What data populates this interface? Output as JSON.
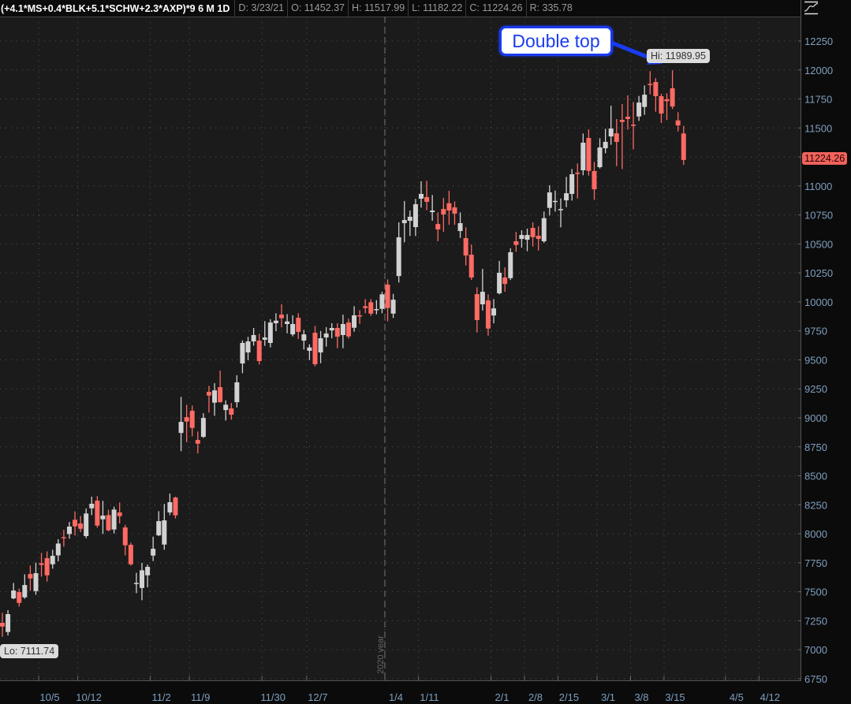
{
  "header": {
    "symbol": "(+4.1*MS+0.4*BLK+5.1*SCHW+2.3*AXP)*9",
    "period": "6 M 1D",
    "date": "D: 3/23/21",
    "open": "O: 11452.37",
    "high": "H: 11517.99",
    "low": "L: 11182.22",
    "close": "C: 11224.26",
    "range": "R: 335.78"
  },
  "annotations": {
    "callout": "Double top",
    "hi_label": "Hi: 11989.95",
    "lo_label": "Lo: 7111.74",
    "last_price": "11224.26",
    "year_marker": "2020 year"
  },
  "colors": {
    "up": "#d2d2d2",
    "down": "#ff6a63",
    "background": "#1b1b1b",
    "axis_text": "#7f9fbf",
    "callout": "#1a3cf0"
  },
  "chart_data": {
    "type": "candlestick",
    "title": "(+4.1*MS+0.4*BLK+5.1*SCHW+2.3*AXP)*9 6 M 1D",
    "ylim": [
      6650,
      12450
    ],
    "y_ticks": [
      12250,
      12000,
      11750,
      11500,
      11250,
      11000,
      10750,
      10500,
      10250,
      10000,
      9750,
      9500,
      9250,
      9000,
      8750,
      8500,
      8250,
      8000,
      7750,
      7500,
      7250,
      7000,
      6750
    ],
    "x_ticks": [
      {
        "label": "10/5",
        "index": 6.5
      },
      {
        "label": "10/12",
        "index": 13.5
      },
      {
        "label": "11/2",
        "index": 26.5
      },
      {
        "label": "11/9",
        "index": 33.5
      },
      {
        "label": "11/30",
        "index": 46.5
      },
      {
        "label": "12/7",
        "index": 54.5
      },
      {
        "label": "1/4",
        "index": 68.5
      },
      {
        "label": "1/11",
        "index": 74.5
      },
      {
        "label": "2/1",
        "index": 87.5
      },
      {
        "label": "2/8",
        "index": 93.5
      },
      {
        "label": "2/15",
        "index": 99.5
      },
      {
        "label": "3/1",
        "index": 106.5
      },
      {
        "label": "3/8",
        "index": 112.5
      },
      {
        "label": "3/15",
        "index": 118.5
      },
      {
        "label": "4/5",
        "index": 129.5
      },
      {
        "label": "4/12",
        "index": 135.5
      }
    ],
    "year_break_index": 68.5,
    "x_range": [
      -0.5,
      143.5
    ],
    "hi_index": 116,
    "lo_index": 0,
    "candles_ohlc": [
      [
        7232,
        7318,
        7112,
        7200
      ],
      [
        7153,
        7341,
        7123,
        7307
      ],
      [
        7443,
        7576,
        7436,
        7511
      ],
      [
        7497,
        7527,
        7372,
        7404
      ],
      [
        7452,
        7651,
        7440,
        7558
      ],
      [
        7653,
        7726,
        7508,
        7615
      ],
      [
        7506,
        7751,
        7474,
        7660
      ],
      [
        7746,
        7835,
        7631,
        7731
      ],
      [
        7790,
        7848,
        7588,
        7642
      ],
      [
        7737,
        7862,
        7699,
        7810
      ],
      [
        7814,
        7953,
        7762,
        7916
      ],
      [
        7971,
        8034,
        7889,
        7962
      ],
      [
        7998,
        8102,
        7957,
        8062
      ],
      [
        8121,
        8193,
        7985,
        8064
      ],
      [
        8089,
        8154,
        8014,
        8043
      ],
      [
        7980,
        8218,
        7962,
        8175
      ],
      [
        8220,
        8320,
        8161,
        8259
      ],
      [
        8286,
        8325,
        8053,
        8071
      ],
      [
        8125,
        8284,
        7998,
        8157
      ],
      [
        8161,
        8207,
        8021,
        8030
      ],
      [
        8037,
        8234,
        8003,
        8209
      ],
      [
        8184,
        8270,
        8089,
        8152
      ],
      [
        8055,
        8077,
        7814,
        7901
      ],
      [
        7905,
        7923,
        7726,
        7737
      ],
      [
        7570,
        7663,
        7488,
        7576
      ],
      [
        7533,
        7749,
        7427,
        7685
      ],
      [
        7642,
        7735,
        7538,
        7715
      ],
      [
        7812,
        7975,
        7765,
        7871
      ],
      [
        7987,
        8195,
        7980,
        8109
      ],
      [
        7907,
        8257,
        7862,
        8116
      ],
      [
        8184,
        8347,
        8161,
        8272
      ],
      [
        8313,
        8320,
        8132,
        8159
      ],
      [
        8870,
        9181,
        8712,
        8965
      ],
      [
        9006,
        9113,
        8791,
        8968
      ],
      [
        9061,
        9106,
        8841,
        8913
      ],
      [
        8809,
        8882,
        8693,
        8777
      ],
      [
        8836,
        9040,
        8827,
        8999
      ],
      [
        9224,
        9276,
        9045,
        9192
      ],
      [
        9131,
        9299,
        9018,
        9237
      ],
      [
        9265,
        9407,
        9131,
        9135
      ],
      [
        9067,
        9151,
        8977,
        9113
      ],
      [
        9081,
        9129,
        8984,
        9027
      ],
      [
        9135,
        9367,
        9090,
        9306
      ],
      [
        9469,
        9668,
        9385,
        9646
      ],
      [
        9564,
        9698,
        9498,
        9659
      ],
      [
        9659,
        9775,
        9623,
        9714
      ],
      [
        9666,
        9725,
        9460,
        9489
      ],
      [
        9673,
        9834,
        9621,
        9693
      ],
      [
        9646,
        9850,
        9607,
        9822
      ],
      [
        9816,
        9902,
        9748,
        9838
      ],
      [
        9890,
        9979,
        9781,
        9859
      ],
      [
        9809,
        9895,
        9729,
        9831
      ],
      [
        9720,
        9884,
        9702,
        9809
      ],
      [
        9863,
        9902,
        9680,
        9741
      ],
      [
        9666,
        9759,
        9589,
        9720
      ],
      [
        9578,
        9634,
        9498,
        9607
      ],
      [
        9734,
        9793,
        9444,
        9462
      ],
      [
        9564,
        9748,
        9471,
        9686
      ],
      [
        9693,
        9782,
        9614,
        9727
      ],
      [
        9754,
        9816,
        9686,
        9775
      ],
      [
        9775,
        9816,
        9600,
        9700
      ],
      [
        9714,
        9890,
        9600,
        9809
      ],
      [
        9822,
        9856,
        9684,
        9702
      ],
      [
        9777,
        9963,
        9743,
        9884
      ],
      [
        9884,
        9929,
        9811,
        9877
      ],
      [
        9963,
        10024,
        9902,
        9947
      ],
      [
        9997,
        10024,
        9879,
        9899
      ],
      [
        9934,
        10015,
        9893,
        9938
      ],
      [
        9940,
        10087,
        9902,
        10065
      ],
      [
        10149,
        10194,
        9833,
        9947
      ],
      [
        9899,
        10069,
        9861,
        10019
      ],
      [
        10223,
        10686,
        10167,
        10557
      ],
      [
        10679,
        10870,
        10514,
        10706
      ],
      [
        10699,
        10788,
        10568,
        10734
      ],
      [
        10645,
        10888,
        10568,
        10842
      ],
      [
        10890,
        11040,
        10813,
        10931
      ],
      [
        10904,
        11044,
        10790,
        10863
      ],
      [
        10774,
        10922,
        10700,
        10788
      ],
      [
        10672,
        10772,
        10523,
        10625
      ],
      [
        10801,
        10897,
        10604,
        10754
      ],
      [
        10851,
        10958,
        10665,
        10788
      ],
      [
        10815,
        10867,
        10665,
        10761
      ],
      [
        10611,
        10772,
        10552,
        10679
      ],
      [
        10550,
        10643,
        10314,
        10400
      ],
      [
        10407,
        10495,
        10189,
        10210
      ],
      [
        10067,
        10126,
        9736,
        9843
      ],
      [
        9979,
        10285,
        9926,
        10087
      ],
      [
        10013,
        10065,
        9709,
        9770
      ],
      [
        9883,
        10024,
        9815,
        9944
      ],
      [
        10074,
        10353,
        10065,
        10251
      ],
      [
        10210,
        10298,
        10087,
        10155
      ],
      [
        10205,
        10462,
        10189,
        10428
      ],
      [
        10523,
        10604,
        10432,
        10491
      ],
      [
        10543,
        10618,
        10468,
        10577
      ],
      [
        10536,
        10632,
        10437,
        10577
      ],
      [
        10638,
        10686,
        10477,
        10559
      ],
      [
        10570,
        10652,
        10443,
        10543
      ],
      [
        10523,
        10779,
        10509,
        10722
      ],
      [
        10811,
        11006,
        10745,
        10944
      ],
      [
        10864,
        10960,
        10779,
        10871
      ],
      [
        10792,
        10892,
        10643,
        10801
      ],
      [
        10876,
        11078,
        10817,
        10937
      ],
      [
        10931,
        11146,
        10874,
        11101
      ],
      [
        11114,
        11194,
        10892,
        11103
      ],
      [
        11135,
        11452,
        11092,
        11373
      ],
      [
        11414,
        11488,
        11089,
        11130
      ],
      [
        11128,
        11207,
        10881,
        10971
      ],
      [
        11162,
        11411,
        11151,
        11332
      ],
      [
        11325,
        11493,
        11282,
        11380
      ],
      [
        11427,
        11692,
        11355,
        11495
      ],
      [
        11454,
        11577,
        11171,
        11380
      ],
      [
        11570,
        11706,
        11146,
        11552
      ],
      [
        11597,
        11781,
        11486,
        11577
      ],
      [
        11529,
        11724,
        11316,
        11518
      ],
      [
        11599,
        11776,
        11561,
        11719
      ],
      [
        11681,
        11867,
        11613,
        11787
      ],
      [
        11880,
        11990,
        11790,
        11871
      ],
      [
        11896,
        11930,
        11640,
        11774
      ],
      [
        11774,
        11794,
        11543,
        11624
      ],
      [
        11747,
        11799,
        11568,
        11731
      ],
      [
        11842,
        11998,
        11663,
        11685
      ],
      [
        11565,
        11636,
        11470,
        11522
      ],
      [
        11452.37,
        11517.99,
        11182.22,
        11224.26
      ]
    ]
  }
}
